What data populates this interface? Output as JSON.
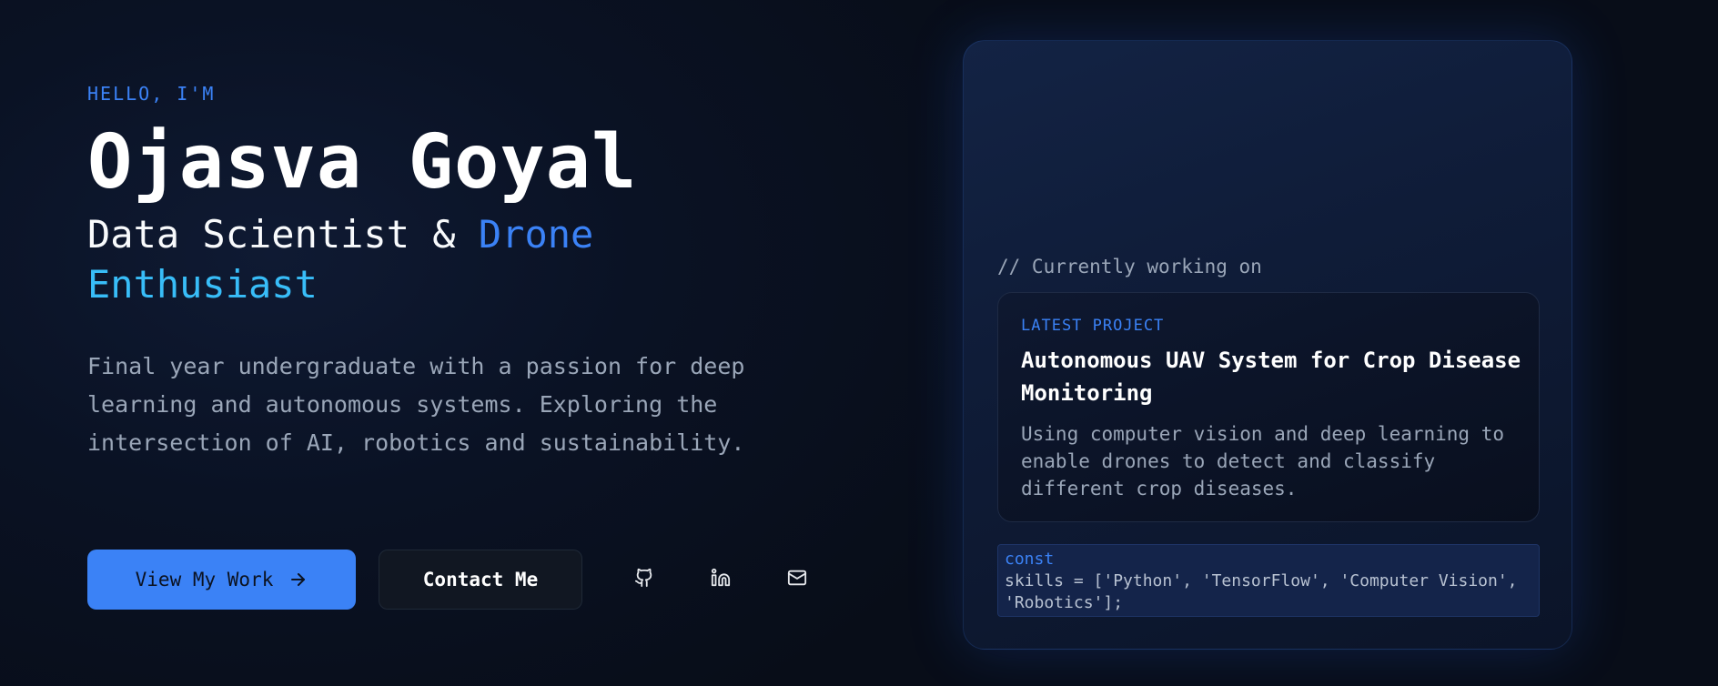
{
  "hero": {
    "greeting": "HELLO, I'M",
    "name": "Ojasva Goyal",
    "role_prefix": "Data Scientist &",
    "role_accent_1": "Drone",
    "role_accent_2": "Enthusiast",
    "bio": "Final year undergraduate with a passion for deep learning and autonomous systems. Exploring the intersection of AI, robotics and sustainability."
  },
  "actions": {
    "primary_label": "View My Work",
    "primary_icon": "arrow-right-icon",
    "secondary_label": "Contact Me"
  },
  "social": [
    {
      "icon": "github-icon"
    },
    {
      "icon": "linkedin-icon"
    },
    {
      "icon": "mail-icon"
    }
  ],
  "card": {
    "working_label": "// Currently working on",
    "project": {
      "tag": "LATEST PROJECT",
      "title": "Autonomous UAV System for Crop Disease Monitoring",
      "description": "Using computer vision and deep learning to enable drones to detect and classify different crop diseases."
    },
    "code": {
      "keyword": "const",
      "line": "skills = ['Python', 'TensorFlow', 'Computer Vision', 'Robotics'];"
    }
  },
  "colors": {
    "accent": "#3b82f6",
    "accent_cyan": "#38bdf8",
    "background": "#080d18",
    "muted_text": "#9aa6b8"
  }
}
